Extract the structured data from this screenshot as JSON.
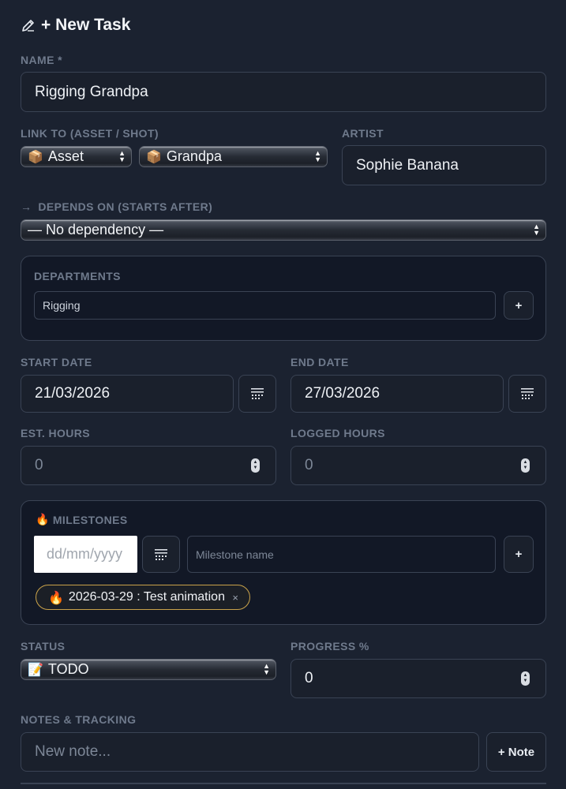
{
  "title": "+ New Task",
  "name": {
    "label": "NAME *",
    "value": "Rigging Grandpa"
  },
  "link": {
    "label": "LINK TO (ASSET / SHOT)",
    "type_emoji": "📦",
    "type_value": "Asset",
    "target_emoji": "📦",
    "target_value": "Grandpa"
  },
  "artist": {
    "label": "ARTIST",
    "value": "Sophie Banana"
  },
  "depends": {
    "label": "DEPENDS ON (STARTS AFTER)",
    "value": "— No dependency —"
  },
  "departments": {
    "label": "DEPARTMENTS",
    "value": "Rigging",
    "add_label": "+"
  },
  "start_date": {
    "label": "START DATE",
    "value": "21/03/2026"
  },
  "end_date": {
    "label": "END DATE",
    "value": "27/03/2026"
  },
  "est_hours": {
    "label": "EST. HOURS",
    "value": "0"
  },
  "logged_hours": {
    "label": "LOGGED HOURS",
    "value": "0"
  },
  "milestones": {
    "emoji": "🔥",
    "label": "MILESTONES",
    "date_placeholder": "dd/mm/yyyy",
    "name_placeholder": "Milestone name",
    "add_label": "+",
    "tags": [
      {
        "emoji": "🔥",
        "text": "2026-03-29 : Test animation",
        "remove": "×"
      }
    ]
  },
  "status": {
    "label": "STATUS",
    "emoji": "📝",
    "value": "TODO"
  },
  "progress": {
    "label": "PROGRESS %",
    "value": "0"
  },
  "notes": {
    "label": "NOTES & TRACKING",
    "placeholder": "New note...",
    "add_label": "+ Note"
  },
  "colors": {
    "background": "#1b2230",
    "panel": "#121826",
    "border": "#3a4354",
    "milestone_tag": "#c9a24a"
  }
}
